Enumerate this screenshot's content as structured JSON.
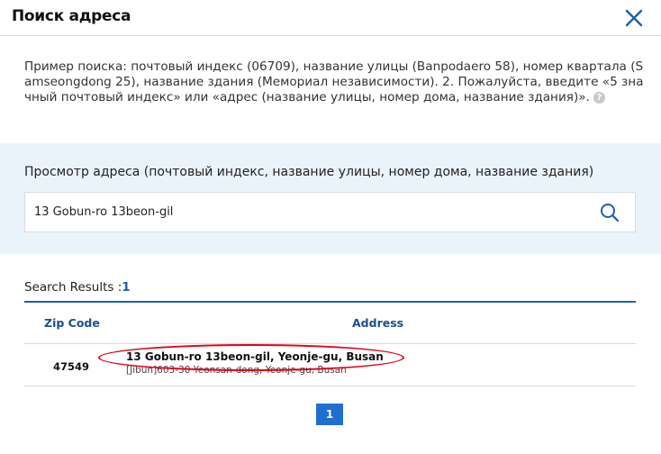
{
  "header": {
    "title": "Поиск адреса",
    "close_icon": "close-icon"
  },
  "description": {
    "text": "Пример поиска: почтовый индекс (06709), название улицы (Banpodaero 58), номер квартала (Samseongdong 25), название здания (Мемориал независимости). 2. Пожалуйста, введите «5 значный почтовый индекс» или «адрес (название улицы, номер дома, название здания)».",
    "help_icon": "question-icon"
  },
  "search": {
    "label": "Просмотр адреса (почтовый индекс, название улицы, номер дома, название здания)",
    "value": "13 Gobun-ro 13beon-gil",
    "button_icon": "search-icon"
  },
  "results": {
    "label": "Search Results :",
    "count": "1",
    "columns": [
      "Zip Code",
      "Address"
    ],
    "rows": [
      {
        "zip": "47549",
        "address": "13 Gobun-ro 13beon-gil, Yeonje-gu, Busan",
        "jibun": "[Jibun]603-30 Yeonsan-dong, Yeonje-gu, Busan"
      }
    ]
  },
  "pagination": {
    "current": "1"
  },
  "colors": {
    "accent": "#1f5fa8",
    "panel_bg": "#eaf2fa",
    "highlight_ellipse": "#e0001b"
  }
}
